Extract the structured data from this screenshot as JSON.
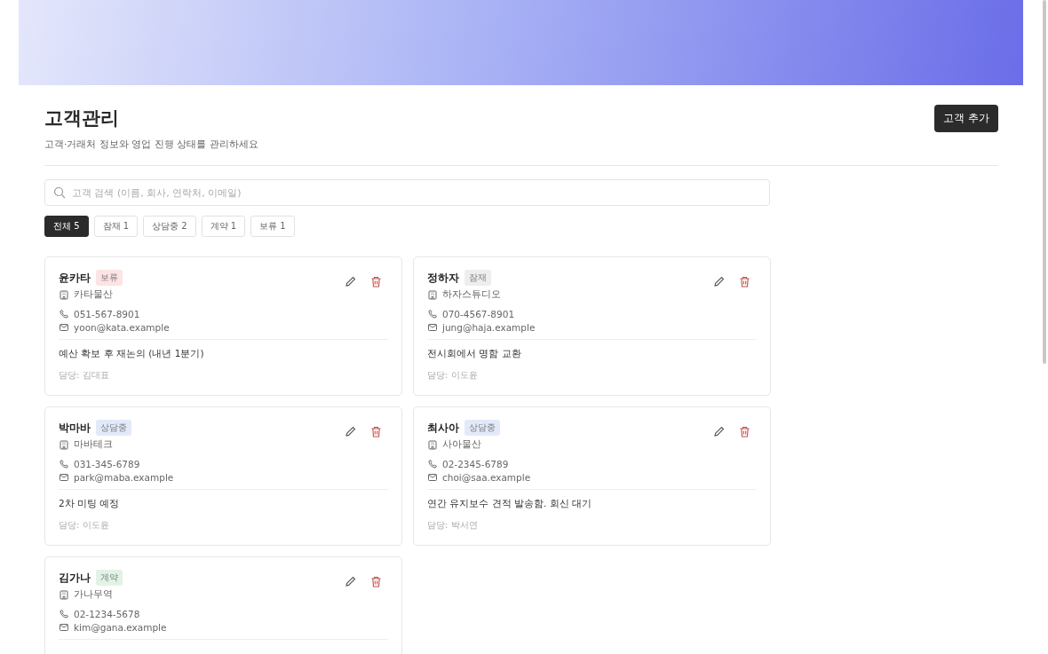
{
  "page": {
    "title": "고객관리",
    "subtitle": "고객·거래처 정보와 영업 진행 상태를 관리하세요",
    "add_button": "고객 추가"
  },
  "search": {
    "placeholder": "고객 검색 (이름, 회사, 연락처, 이메일)"
  },
  "filters": [
    {
      "label": "전체 5",
      "selected": true
    },
    {
      "label": "잠재 1",
      "selected": false
    },
    {
      "label": "상담중 2",
      "selected": false
    },
    {
      "label": "계약 1",
      "selected": false
    },
    {
      "label": "보류 1",
      "selected": false
    }
  ],
  "customers": [
    {
      "name": "윤카타",
      "status": "보류",
      "color": "#fbe4e3",
      "company": "카타물산",
      "phone": "051-567-8901",
      "email": "yoon@kata.example",
      "note": "예산 확보 후 재논의 (내년 1분기)",
      "manager": "담당: 김대표"
    },
    {
      "name": "정하자",
      "status": "잠재",
      "color": "#eeeeee",
      "company": "하자스튜디오",
      "phone": "070-4567-8901",
      "email": "jung@haja.example",
      "note": "전시회에서 명함 교환",
      "manager": "담당: 이도윤"
    },
    {
      "name": "박마바",
      "status": "상담중",
      "color": "#e2eafa",
      "company": "마바테크",
      "phone": "031-345-6789",
      "email": "park@maba.example",
      "note": "2차 미팅 예정",
      "manager": "담당: 이도윤"
    },
    {
      "name": "최사아",
      "status": "상담중",
      "color": "#e2eafa",
      "company": "사아물산",
      "phone": "02-2345-6789",
      "email": "choi@saa.example",
      "note": "연간 유지보수 견적 발송함. 회신 대기",
      "manager": "담당: 박서연"
    },
    {
      "name": "김가나",
      "status": "계약",
      "color": "#e2f3e6",
      "company": "가나무역",
      "phone": "02-1234-5678",
      "email": "kim@gana.example"
    }
  ]
}
